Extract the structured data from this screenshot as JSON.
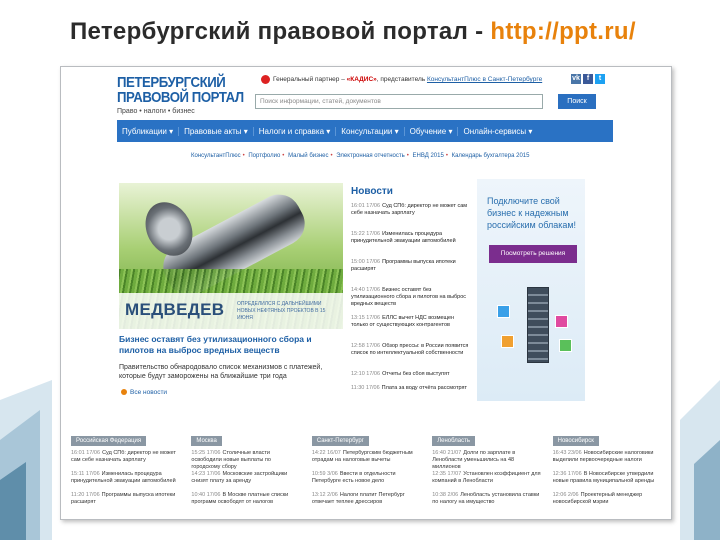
{
  "slide": {
    "title_main": "Петербургский правовой портал - ",
    "title_url": "http://ppt.ru/"
  },
  "header": {
    "logo_line1": "ПЕТЕРБУРГСКИЙ",
    "logo_line2": "ПРАВОВОЙ ПОРТАЛ",
    "logo_line3": "Право • налоги • бизнес",
    "partner_prefix": "Генеральный партнер –",
    "partner_name": "«КАДИС»",
    "partner_mid": ", представитель",
    "partner_link": "КонсультантПлюс в Санкт-Петербурге",
    "search_placeholder": "Поиск информации, статей, документов",
    "search_button": "Поиск",
    "social": [
      "vk",
      "f",
      "t"
    ]
  },
  "nav": {
    "items": [
      "Публикации ▾",
      "Правовые акты ▾",
      "Налоги и справка ▾",
      "Консультации ▾",
      "Обучение ▾",
      "Онлайн-сервисы ▾"
    ]
  },
  "breadcrumbs": [
    "КонсультантПлюс",
    "Портфолио",
    "Малый бизнес",
    "Электронная отчетность",
    "ЕНВД 2015",
    "Календарь бухгалтера 2015"
  ],
  "feature": {
    "banner_big": "МЕДВЕДЕВ",
    "banner_small": "ОПРЕДЕЛИЛСЯ С ДАЛЬНЕЙШИМИ НОВЫХ НЕФТЯНЫХ ПРОЕКТОВ В 15 ИЮНЯ",
    "headline": "Бизнес оставят без утилизационного сбора и пилотов на выброс вредных веществ",
    "text": "Правительство обнародовало список механизмов с платежей, которые будут заморожены на ближайшие три года",
    "more": "Все новости"
  },
  "news": {
    "title": "Новости",
    "items": [
      {
        "time": "16:01 17/06",
        "text": "Суд СПб: директор не может сам себе назначать зарплату"
      },
      {
        "time": "15:22 17/06",
        "text": "Изменилась процедура принудительной эвакуации автомобилей"
      },
      {
        "time": "15:00 17/06",
        "text": "Программы выпуска ипотеки расширят"
      },
      {
        "time": "14:40 17/06",
        "text": "Бизнес оставят без утилизационного сбора и пилотов на выброс вредных веществ"
      },
      {
        "time": "13:15 17/06",
        "text": "ЕЛЛС вычет НДС возмещен только от существующих контрагентов"
      },
      {
        "time": "12:58 17/06",
        "text": "Обзор прессы: в России появится список по интеллектуальной собственности"
      },
      {
        "time": "12:10 17/06",
        "text": "Отчеты без сбоя выступят"
      },
      {
        "time": "11:30 17/06",
        "text": "Плата за воду отчёта рассмотрят"
      }
    ]
  },
  "ad": {
    "text": "Подключите свой бизнес к надежным российским облакам!",
    "button": "Посмотреть решения"
  },
  "regions": [
    {
      "tab": "Российская Федерация",
      "items": [
        {
          "time": "16:01 17/06",
          "text": "Суд СПб: директор не может сам себе назначать зарплату"
        },
        {
          "time": "15:11 17/06",
          "text": "Изменилась процедура принудительной эвакуации автомобилей"
        },
        {
          "time": "11:20 17/06",
          "text": "Программы выпуска ипотеки расширят"
        }
      ]
    },
    {
      "tab": "Москва",
      "items": [
        {
          "time": "15:25 17/06",
          "text": "Столичные власти освободили новые выплаты по городскому сбору"
        },
        {
          "time": "14:23 17/06",
          "text": "Московские застройщики снизят плату за аренду"
        },
        {
          "time": "10:40 17/06",
          "text": "В Москве платные списки программ освободят от налогов"
        }
      ]
    },
    {
      "tab": "Санкт-Петербург",
      "items": [
        {
          "time": "14:22 16/07",
          "text": "Петербургским бюджетным отрадам на налоговые вычеты"
        },
        {
          "time": "10:59 3/06",
          "text": "Ввести в отдельности Петербурге есть новое дело"
        },
        {
          "time": "13:12 2/06",
          "text": "Налоги платит Петербург отвечает теплее дрессиров"
        }
      ]
    },
    {
      "tab": "Ленобласть",
      "items": [
        {
          "time": "16:40 21/07",
          "text": "Долги по зарплате в Ленобласти уменьшились на 48 миллионов"
        },
        {
          "time": "12:35 17/07",
          "text": "Установлен коэффициент для компаний в Ленобласти"
        },
        {
          "time": "10:38 2/06",
          "text": "Ленобласть установила ставки по налогу на имущество"
        }
      ]
    },
    {
      "tab": "Новосибирск",
      "items": [
        {
          "time": "16:43 23/06",
          "text": "Новосибирские налоговики выделили первоочередные налоги"
        },
        {
          "time": "12:36 17/06",
          "text": "В Новосибирске утвердили новые правила муниципальной аренды"
        },
        {
          "time": "12:06 2/06",
          "text": "Проектерный менеджер новосибирской мэрии"
        }
      ]
    }
  ],
  "colors": {
    "accent": "#e8820c",
    "brand_blue": "#1d5fa5",
    "nav_blue": "#2a72c4",
    "ad_button": "#7b2d8e"
  }
}
